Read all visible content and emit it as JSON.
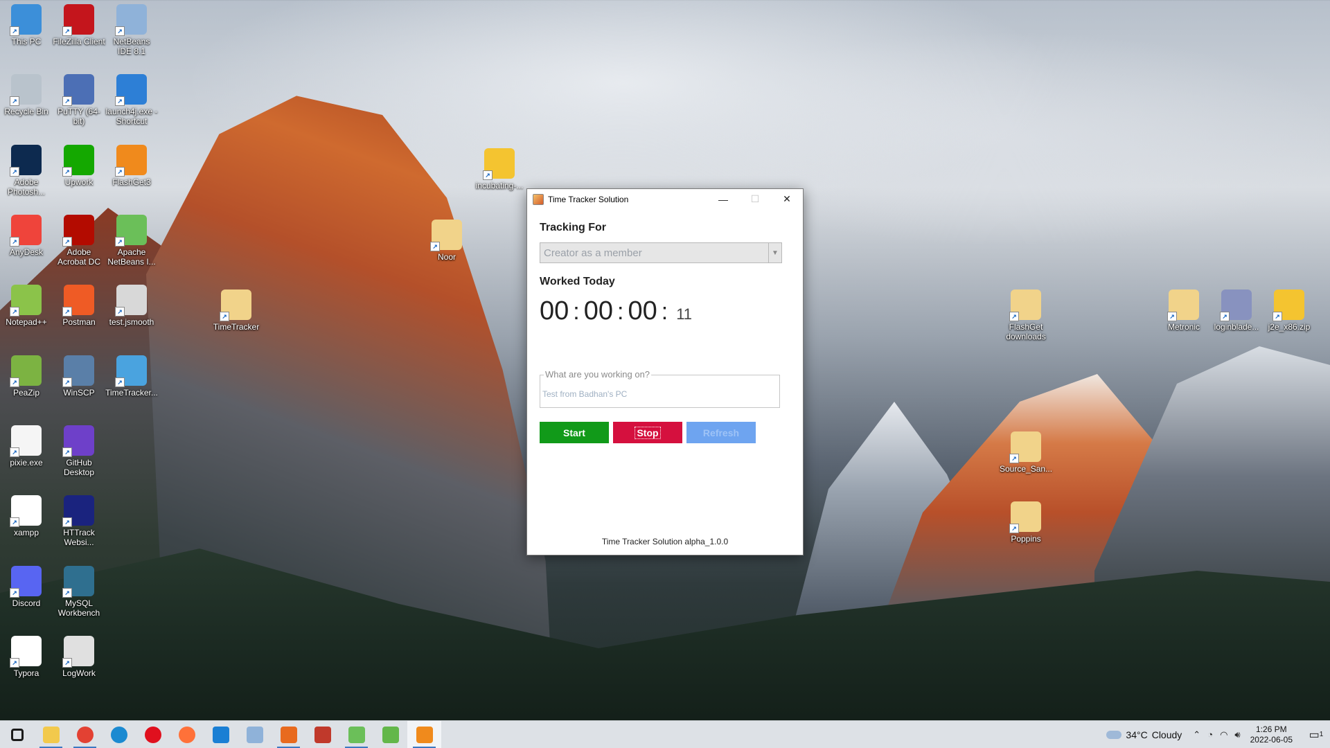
{
  "desktop": {
    "icons": [
      {
        "label": "This PC",
        "icon": "computer-icon",
        "color": "#3c8fd9"
      },
      {
        "label": "FileZilla Client",
        "icon": "filezilla-icon",
        "color": "#c4151c"
      },
      {
        "label": "NetBeans IDE 8.1",
        "icon": "netbeans-icon",
        "color": "#8fb2d9"
      },
      {
        "label": "Recycle Bin",
        "icon": "recycle-bin-icon",
        "color": "#b9c3cc"
      },
      {
        "label": "PuTTY (64-bit)",
        "icon": "putty-icon",
        "color": "#4c6fb5"
      },
      {
        "label": "launch4j.exe - Shortcut",
        "icon": "launch4j-icon",
        "color": "#2d7fd6"
      },
      {
        "label": "Adobe Photosh...",
        "icon": "photoshop-icon",
        "color": "#0d2a4f"
      },
      {
        "label": "Upwork",
        "icon": "upwork-icon",
        "color": "#14a800"
      },
      {
        "label": "FlashGet3",
        "icon": "flashget-icon",
        "color": "#f08a1c"
      },
      {
        "label": "AnyDesk",
        "icon": "anydesk-icon",
        "color": "#ef443b"
      },
      {
        "label": "Adobe Acrobat DC",
        "icon": "acrobat-icon",
        "color": "#b30b00"
      },
      {
        "label": "Apache NetBeans I...",
        "icon": "apache-netbeans-icon",
        "color": "#6bbf59"
      },
      {
        "label": "Notepad++",
        "icon": "notepadpp-icon",
        "color": "#8bc34a"
      },
      {
        "label": "Postman",
        "icon": "postman-icon",
        "color": "#ef5b25"
      },
      {
        "label": "test.jsmooth",
        "icon": "jar-file-icon",
        "color": "#d8d8d8"
      },
      {
        "label": "PeaZip",
        "icon": "peazip-icon",
        "color": "#7cb342"
      },
      {
        "label": "WinSCP",
        "icon": "winscp-icon",
        "color": "#5a7fa8"
      },
      {
        "label": "TimeTracker...",
        "icon": "timetracker-file-icon",
        "color": "#4aa3df"
      },
      {
        "label": "pixie.exe",
        "icon": "pixie-icon",
        "color": "#f5f5f5"
      },
      {
        "label": "GitHub Desktop",
        "icon": "github-icon",
        "color": "#6e40c9"
      },
      {
        "label": "xampp",
        "icon": "file-icon",
        "color": "#ffffff"
      },
      {
        "label": "HTTrack Websi...",
        "icon": "httrack-icon",
        "color": "#1a237e"
      },
      {
        "label": "Discord",
        "icon": "discord-icon",
        "color": "#5865f2"
      },
      {
        "label": "MySQL Workbench",
        "icon": "mysql-icon",
        "color": "#2f6f8f"
      },
      {
        "label": "Typora",
        "icon": "typora-icon",
        "color": "#ffffff"
      },
      {
        "label": "LogWork",
        "icon": "logwork-icon",
        "color": "#e0e0e0"
      },
      {
        "label": "incubating-...",
        "icon": "zip-icon",
        "color": "#f4c430"
      },
      {
        "label": "Noor",
        "icon": "folder-icon",
        "color": "#f1d38a"
      },
      {
        "label": "TimeTracker",
        "icon": "folder-icon",
        "color": "#f1d38a"
      },
      {
        "label": "FlashGet downloads",
        "icon": "folder-icon",
        "color": "#f1d38a"
      },
      {
        "label": "Source_San...",
        "icon": "folder-icon",
        "color": "#f1d38a"
      },
      {
        "label": "Poppins",
        "icon": "folder-icon",
        "color": "#f1d38a"
      },
      {
        "label": "Metronic",
        "icon": "folder-icon",
        "color": "#f1d38a"
      },
      {
        "label": "loginblade...",
        "icon": "php-file-icon",
        "color": "#8892bf"
      },
      {
        "label": "j2e_x86.zip",
        "icon": "zip-icon",
        "color": "#f4c430"
      }
    ]
  },
  "window": {
    "title": "Time Tracker Solution",
    "tracking_label": "Tracking For",
    "tracking_value": "Creator as a member",
    "worked_label": "Worked Today",
    "timer": {
      "h": "00",
      "m": "00",
      "s": "00",
      "sep": ":",
      "ms": "11"
    },
    "task_legend": "What are you working on?",
    "task_value": "Test from Badhan's PC",
    "start_label": "Start",
    "stop_label": "Stop",
    "refresh_label": "Refresh",
    "footer": "Time Tracker Solution alpha_1.0.0",
    "colors": {
      "start": "#119a19",
      "stop": "#d5103e",
      "refresh": "#6ea4f0"
    }
  },
  "taskbar": {
    "apps": [
      {
        "name": "start-button",
        "icon": "windows-icon",
        "color": "#1a1a1a"
      },
      {
        "name": "file-explorer",
        "icon": "folder-icon",
        "color": "#f2c94c"
      },
      {
        "name": "chrome",
        "icon": "chrome-icon",
        "color": "#e34133"
      },
      {
        "name": "edge",
        "icon": "edge-icon",
        "color": "#1b8ad1"
      },
      {
        "name": "opera",
        "icon": "opera-icon",
        "color": "#e0101e"
      },
      {
        "name": "firefox",
        "icon": "firefox-icon",
        "color": "#ff7139"
      },
      {
        "name": "vscode",
        "icon": "vscode-icon",
        "color": "#1a7fd4"
      },
      {
        "name": "netbeans",
        "icon": "netbeans-icon",
        "color": "#8fb2d9"
      },
      {
        "name": "app-orange",
        "icon": "app-icon",
        "color": "#e86a1e"
      },
      {
        "name": "java-app",
        "icon": "java-icon",
        "color": "#c0392b"
      },
      {
        "name": "app-diamond",
        "icon": "app-icon",
        "color": "#6bbf59"
      },
      {
        "name": "apache-netbeans",
        "icon": "apache-netbeans-icon",
        "color": "#63b74a"
      },
      {
        "name": "time-tracker",
        "icon": "java-icon",
        "color": "#f08a1c"
      }
    ],
    "weather_temp": "34°C",
    "weather_text": "Cloudy",
    "time": "1:26 PM",
    "date": "2022-06-05",
    "notification_count": "1"
  }
}
